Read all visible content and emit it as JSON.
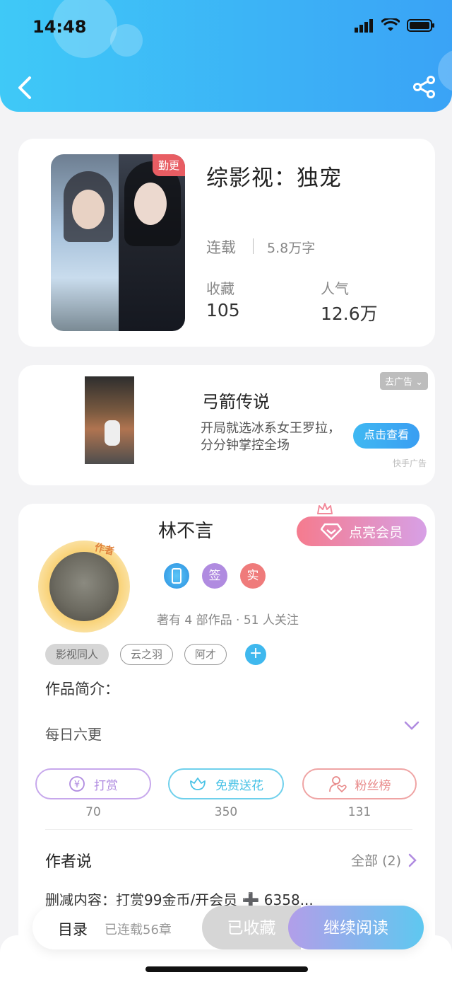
{
  "status_bar": {
    "time": "14:48"
  },
  "book": {
    "badge": "勤更",
    "title": "综影视：独宠",
    "status": "连载",
    "word_count": "5.8万字",
    "collect_label": "收藏",
    "collect_value": "105",
    "popularity_label": "人气",
    "popularity_value": "12.6万"
  },
  "ad": {
    "title": "弓箭传说",
    "description": "开局就选冰系女王罗拉，分分钟掌控全场",
    "cta": "点击查看",
    "close_tag": "去广告",
    "source": "快手广告"
  },
  "author": {
    "name": "林不言",
    "avatar_tag": "作者",
    "vip_button": "点亮会员",
    "badges": [
      "签",
      "实"
    ],
    "meta": "著有 4 部作品 · 51 人关注",
    "tags": [
      "影视同人",
      "云之羽",
      "阿才"
    ],
    "intro_label": "作品简介：",
    "intro_text": "每日六更"
  },
  "actions": [
    {
      "label": "打赏",
      "count": "70",
      "color": "#b08be0"
    },
    {
      "label": "免费送花",
      "count": "350",
      "color": "#48c2e6"
    },
    {
      "label": "粉丝榜",
      "count": "131",
      "color": "#e88a8a"
    }
  ],
  "author_says": {
    "title": "作者说",
    "all_label": "全部 (2)",
    "content": "删减内容：打赏99金币/开会员 ➕ 6358..."
  },
  "bottom": {
    "toc": "目录",
    "chapters": "已连载56章",
    "collected": "已收藏",
    "read": "继续阅读"
  }
}
